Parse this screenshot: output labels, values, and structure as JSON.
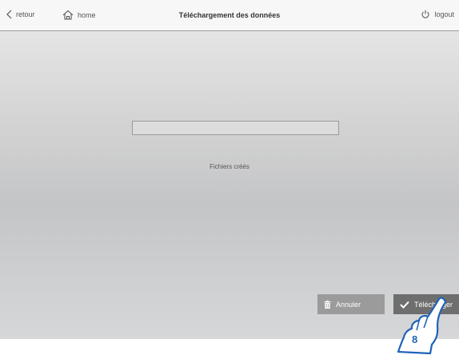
{
  "topbar": {
    "back_label": "retour",
    "home_label": "home",
    "title": "Téléchargement des données",
    "logout_label": "logout"
  },
  "progress": {
    "fraction": 0.0
  },
  "status_text": "Fichiers créés",
  "actions": {
    "cancel_label": "Annuler",
    "download_label": "Télécharger"
  },
  "callout": {
    "step_number": "8"
  },
  "icons": [
    "chevron-left-icon",
    "home-icon",
    "power-icon",
    "trash-icon",
    "checkmark-icon",
    "pointing-hand-icon"
  ]
}
